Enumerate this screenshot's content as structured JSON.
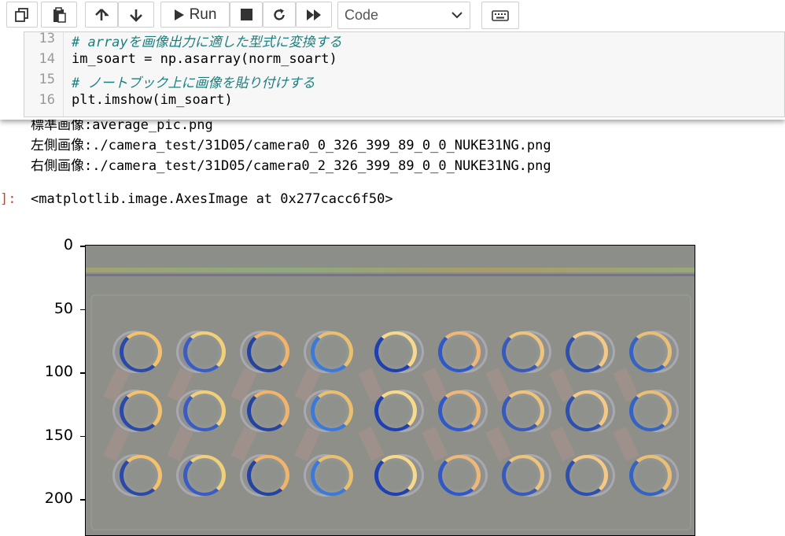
{
  "toolbar": {
    "run_label": "Run",
    "cell_type": "Code"
  },
  "code_cell": {
    "lines": [
      {
        "num": "13",
        "text": "# arrayを画像出力に適した型式に変換する"
      },
      {
        "num": "14",
        "text": "im_soart = np.asarray(norm_soart)"
      },
      {
        "num": "15",
        "text": "# ノートブック上に画像を貼り付けする"
      },
      {
        "num": "16",
        "text": "plt.imshow(im_soart)"
      }
    ]
  },
  "output": {
    "stdout": [
      "標準画像:average_pic.png",
      "左側画像:./camera_test/31D05/camera0_0_326_399_89_0_0_NUKE31NG.png",
      "右側画像:./camera_test/31D05/camera0_2_326_399_89_0_0_NUKE31NG.png"
    ],
    "prompt": "]:",
    "result": "<matplotlib.image.AxesImage at 0x277cacc6f50>"
  },
  "plot": {
    "y_ticks": [
      "0",
      "50",
      "100",
      "150",
      "200"
    ],
    "y_tick_values": [
      0,
      50,
      100,
      150,
      200
    ],
    "grid_rows": 3,
    "grid_cols": 9
  },
  "colors": {
    "comment": "#1a7f7f",
    "operator": "#aa22ff",
    "prompt": "#d84315",
    "image_gray": "#8c8f89"
  }
}
